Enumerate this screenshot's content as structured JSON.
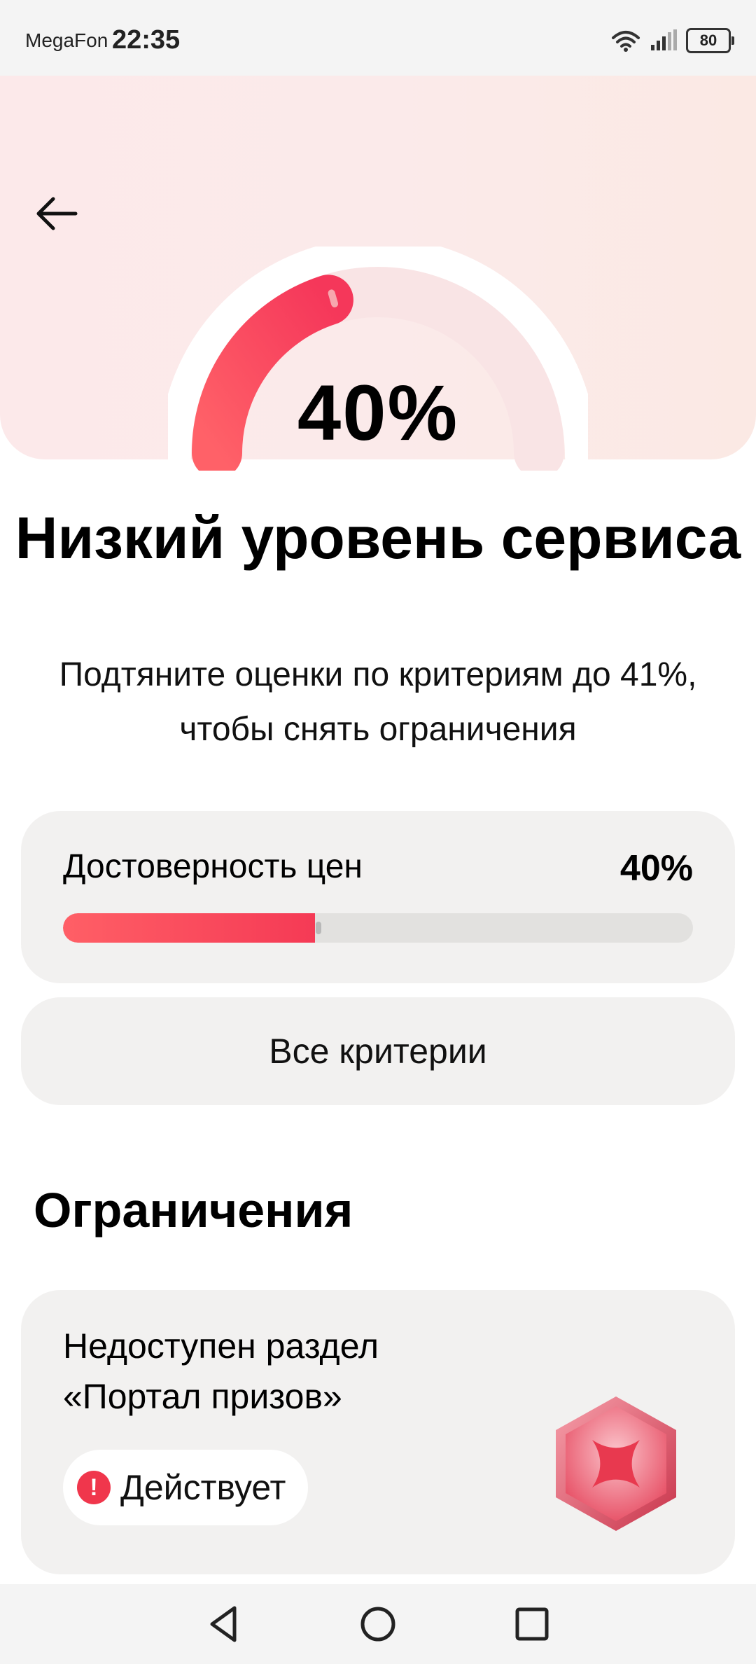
{
  "status_bar": {
    "carrier": "MegaFon",
    "time": "22:35",
    "battery": "80"
  },
  "gauge": {
    "value_label": "40%",
    "percent": 40,
    "target_percent": 41
  },
  "title": "Низкий уровень сервиса",
  "subtitle": "Подтяните оценки по критериям до 41%, чтобы снять ограничения",
  "criterion": {
    "label": "Достоверность цен",
    "value_label": "40%",
    "percent": 40,
    "target_percent": 41
  },
  "all_criteria_button": "Все критерии",
  "restrictions": {
    "heading": "Ограничения",
    "items": [
      {
        "text": "Недоступен раздел «Портал призов»",
        "status": "Действует"
      }
    ]
  },
  "colors": {
    "accent": "#f53a55",
    "card": "#f2f1f0"
  },
  "icons": [
    "back-arrow-icon",
    "wifi-icon",
    "signal-icon",
    "battery-icon",
    "alert-icon",
    "nav-back-icon",
    "nav-home-icon",
    "nav-recents-icon"
  ]
}
